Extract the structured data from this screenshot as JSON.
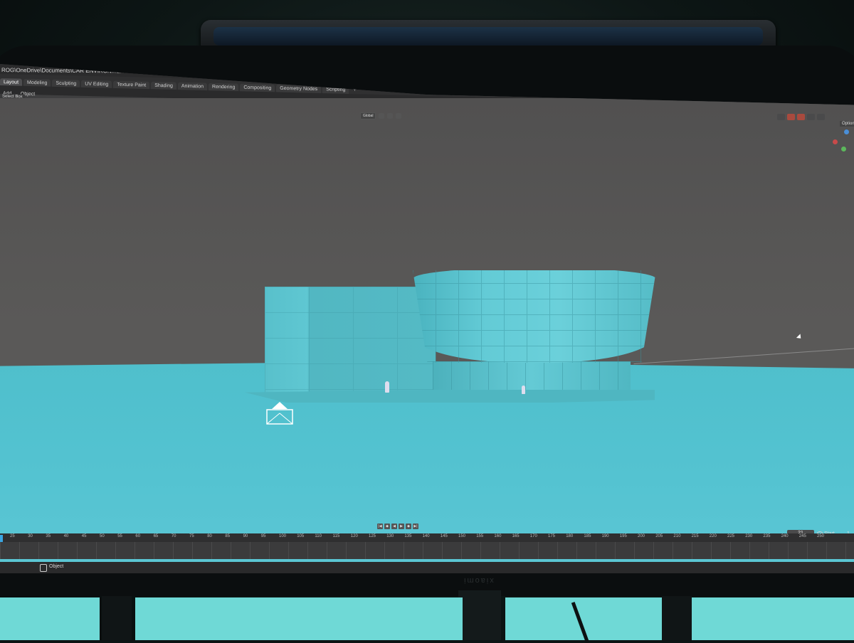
{
  "window": {
    "title": "ROG\\OneDrive\\Documents\\CAR ENVIRONMENT 1.blend) - Blender 4.1"
  },
  "workspace_tabs": [
    "Layout",
    "Modeling",
    "Sculpting",
    "UV Editing",
    "Texture Paint",
    "Shading",
    "Animation",
    "Rendering",
    "Compositing",
    "Geometry Nodes",
    "Scripting"
  ],
  "workspace_add": "+",
  "active_tab": "Layout",
  "editor_menu": [
    "Add",
    "Object"
  ],
  "select_mode": "Select Box",
  "viewport": {
    "transform_orientation": "Global",
    "options_label": "Options"
  },
  "timeline": {
    "current_frame": "21",
    "start_label": "Start",
    "start_value": "1",
    "ruler_ticks": [
      "25",
      "30",
      "35",
      "40",
      "45",
      "50",
      "55",
      "60",
      "65",
      "70",
      "75",
      "80",
      "85",
      "90",
      "95",
      "100",
      "105",
      "110",
      "115",
      "120",
      "125",
      "130",
      "135",
      "140",
      "145",
      "150",
      "155",
      "160",
      "165",
      "170",
      "175",
      "180",
      "185",
      "190",
      "195",
      "200",
      "205",
      "210",
      "215",
      "220",
      "225",
      "230",
      "235",
      "240",
      "245",
      "250"
    ]
  },
  "status": {
    "mode": "Object"
  },
  "monitor": {
    "brand": "xiaomi"
  },
  "colors": {
    "floor": "#54c3d1",
    "building": "#5cc4cf",
    "viewport_bg": "#585756"
  },
  "icons": {
    "playback_controls": [
      "jump-start-icon",
      "prev-keyframe-icon",
      "play-reverse-icon",
      "play-icon",
      "next-keyframe-icon",
      "jump-end-icon"
    ]
  }
}
